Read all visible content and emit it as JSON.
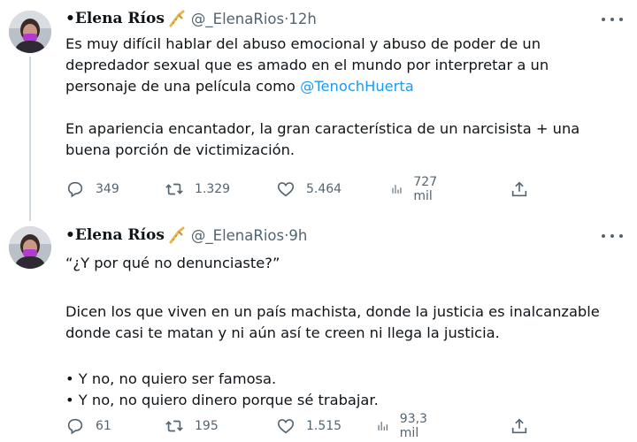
{
  "tweets": [
    {
      "author_name": "•Elena Ríos",
      "handle": "@_ElenaRios",
      "time": "12h",
      "text_parts": [
        "Es muy difícil hablar del abuso emocional y abuso de poder de un",
        "depredador sexual que es amado en el mundo por interpretar a un",
        "personaje de una película como ",
        "@TenochHuerta",
        "En apariencia encantador, la gran característica de un narcisista + una",
        "buena porción de victimización."
      ],
      "replies": "349",
      "retweets": "1.329",
      "likes": "5.464",
      "views": "727 mil"
    },
    {
      "author_name": "•Elena Ríos",
      "handle": "@_ElenaRios",
      "time": "9h",
      "text_parts": [
        "“¿Y por qué no denunciaste?”",
        "Dicen los que viven en un país machista, donde la justicia es inalcanzable",
        "donde casi te matan y ni aún así te creen ni llega la justicia.",
        "• Y no, no quiero ser famosa.",
        "• Y no, no quiero dinero porque sé trabajar."
      ],
      "replies": "61",
      "retweets": "195",
      "likes": "1.515",
      "views": "93,3 mil"
    }
  ],
  "separator": " · ",
  "colors": {
    "text": "#0f1419",
    "secondary": "#536471",
    "link": "#1d9bf0",
    "thread_line": "#cfd9de",
    "badge_gold": "#e8b64a"
  },
  "icons": {
    "badge": "saxophone-emoji",
    "more": "more-dots-icon",
    "reply": "reply-icon",
    "retweet": "retweet-icon",
    "like": "heart-icon",
    "views": "views-chart-icon",
    "share": "share-icon"
  }
}
